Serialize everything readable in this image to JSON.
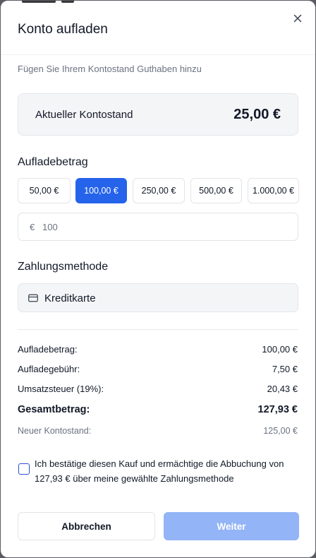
{
  "dialog": {
    "title": "Konto aufladen",
    "subtitle": "Fügen Sie Ihrem Kontostand Guthaben hinzu"
  },
  "balance": {
    "label": "Aktueller Kontostand",
    "value": "25,00 €"
  },
  "amount_section": {
    "heading": "Aufladebetrag",
    "options": [
      "50,00 €",
      "100,00 €",
      "250,00 €",
      "500,00 €",
      "1.000,00 €"
    ],
    "selected": "100,00 €",
    "currency_symbol": "€",
    "input_value": "100"
  },
  "payment_section": {
    "heading": "Zahlungsmethode",
    "method": "Kreditkarte",
    "icon": "credit-card-icon"
  },
  "summary": {
    "rows": [
      {
        "label": "Aufladebetrag:",
        "value": "100,00 €"
      },
      {
        "label": "Aufladegebühr:",
        "value": "7,50 €"
      },
      {
        "label": "Umsatzsteuer (19%):",
        "value": "20,43 €"
      }
    ],
    "total_label": "Gesamtbetrag:",
    "total_value": "127,93 €",
    "new_balance_label": "Neuer Kontostand:",
    "new_balance_value": "125,00 €"
  },
  "confirmation": {
    "checked": false,
    "text": "Ich bestätige diesen Kauf und ermächtige die Abbuchung von 127,93 € über meine gewählte Zahlungsmethode"
  },
  "actions": {
    "cancel_label": "Abbrechen",
    "next_label": "Weiter",
    "next_disabled": true
  },
  "colors": {
    "accent": "#2563eb",
    "accent_disabled": "#93b4f6",
    "checkbox_border": "#2f4dcc"
  }
}
